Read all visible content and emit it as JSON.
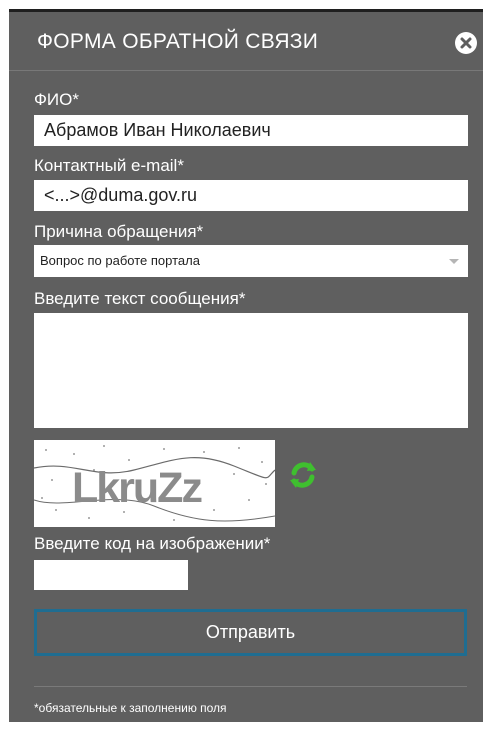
{
  "form": {
    "title": "ФОРМА ОБРАТНОЙ СВЯЗИ",
    "fio_label": "ФИО*",
    "fio_value": "Абрамов Иван Николаевич",
    "email_label": "Контактный e-mail*",
    "email_value": "<...>@duma.gov.ru",
    "reason_label": "Причина обращения*",
    "reason_selected": "Вопрос по работе портала",
    "message_label": "Введите текст сообщения*",
    "message_value": "",
    "captcha_text": "LkruZz",
    "captcha_label": "Введите код на изображении*",
    "captcha_value": "",
    "submit_label": "Отправить",
    "required_note": "*обязательные к заполнению поля"
  },
  "icons": {
    "close": "close-icon",
    "refresh": "refresh-icon"
  },
  "colors": {
    "panel_bg": "#5f5f5f",
    "submit_border": "#1f6d91",
    "refresh_green": "#3fbf2f"
  }
}
